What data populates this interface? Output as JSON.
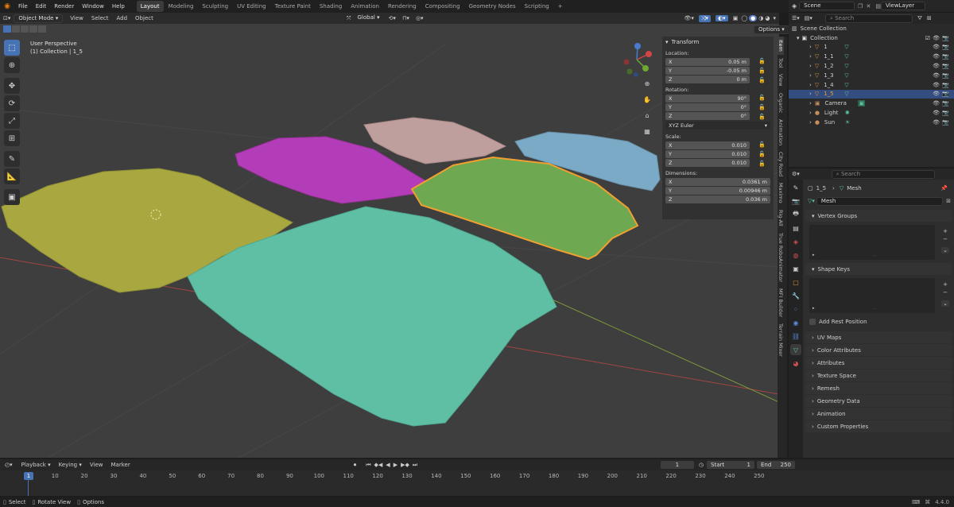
{
  "menu": {
    "items": [
      "File",
      "Edit",
      "Render",
      "Window",
      "Help"
    ],
    "workspaces": [
      "Layout",
      "Modeling",
      "Sculpting",
      "UV Editing",
      "Texture Paint",
      "Shading",
      "Animation",
      "Rendering",
      "Compositing",
      "Geometry Nodes",
      "Scripting"
    ],
    "active_workspace": "Layout",
    "add_tab": "+",
    "scene": "Scene",
    "view_layer": "ViewLayer"
  },
  "viewport": {
    "mode": "Object Mode",
    "menus": [
      "View",
      "Select",
      "Add",
      "Object"
    ],
    "orientation": "Global",
    "options": "Options",
    "perspective": "User Perspective",
    "collection_info": "(1) Collection | 1_5",
    "gizmo": {
      "x": "X",
      "y": "Y",
      "z": "Z"
    }
  },
  "transform": {
    "title": "Transform",
    "location_label": "Location:",
    "location": [
      {
        "axis": "X",
        "value": "0.05 m"
      },
      {
        "axis": "Y",
        "value": "-0.05 m"
      },
      {
        "axis": "Z",
        "value": "0 m"
      }
    ],
    "rotation_label": "Rotation:",
    "rotation": [
      {
        "axis": "X",
        "value": "90°"
      },
      {
        "axis": "Y",
        "value": "0°"
      },
      {
        "axis": "Z",
        "value": "0°"
      }
    ],
    "rotation_mode": "XYZ Euler",
    "scale_label": "Scale:",
    "scale": [
      {
        "axis": "X",
        "value": "0.010"
      },
      {
        "axis": "Y",
        "value": "0.010"
      },
      {
        "axis": "Z",
        "value": "0.010"
      }
    ],
    "dimensions_label": "Dimensions:",
    "dimensions": [
      {
        "axis": "X",
        "value": "0.0361 m"
      },
      {
        "axis": "Y",
        "value": "0.00946 m"
      },
      {
        "axis": "Z",
        "value": "0.036 m"
      }
    ]
  },
  "sidebar_tabs": [
    "Item",
    "Tool",
    "View",
    "Organic",
    "Animation",
    "City Road",
    "Maximo",
    "Rig-All",
    "True RoboAnimator",
    "MFI Builder",
    "Terrain Mixer"
  ],
  "outliner": {
    "search_placeholder": "Search",
    "root": "Scene Collection",
    "collection": "Collection",
    "objects": [
      {
        "name": "1",
        "color": "#e0943a",
        "selected": false
      },
      {
        "name": "1_1",
        "color": "#e0943a",
        "selected": false
      },
      {
        "name": "1_2",
        "color": "#e0943a",
        "selected": false
      },
      {
        "name": "1_3",
        "color": "#e0943a",
        "selected": false
      },
      {
        "name": "1_4",
        "color": "#e0943a",
        "selected": false
      },
      {
        "name": "1_5",
        "color": "#e0943a",
        "selected": true
      },
      {
        "name": "Camera",
        "color": "#c48f5c",
        "selected": false
      },
      {
        "name": "Light",
        "color": "#c48f5c",
        "selected": false
      },
      {
        "name": "Sun",
        "color": "#c48f5c",
        "selected": false
      }
    ]
  },
  "properties": {
    "search_placeholder": "Search",
    "breadcrumb_object": "1_5",
    "breadcrumb_data": "Mesh",
    "mesh_name": "Mesh",
    "vertex_groups": "Vertex Groups",
    "shape_keys": "Shape Keys",
    "add_rest_position": "Add Rest Position",
    "panels": [
      "UV Maps",
      "Color Attributes",
      "Attributes",
      "Texture Space",
      "Remesh",
      "Geometry Data",
      "Animation",
      "Custom Properties"
    ]
  },
  "timeline": {
    "menus": [
      "Playback",
      "Keying",
      "View",
      "Marker"
    ],
    "current_frame": "1",
    "start_label": "Start",
    "start": "1",
    "end_label": "End",
    "end": "250",
    "ticks": [
      "1",
      "10",
      "20",
      "30",
      "40",
      "50",
      "60",
      "70",
      "80",
      "90",
      "100",
      "110",
      "120",
      "130",
      "140",
      "150",
      "160",
      "170",
      "180",
      "190",
      "200",
      "210",
      "220",
      "230",
      "240",
      "250"
    ]
  },
  "status": {
    "select": "Select",
    "rotate": "Rotate View",
    "options": "Options",
    "version": "4.4.0"
  },
  "colors": {
    "terrain_yellow": "#a9a840",
    "terrain_teal": "#5fbfa5",
    "terrain_magenta": "#b33db8",
    "terrain_pink": "#bf9e9e",
    "terrain_blue": "#7aaac5",
    "terrain_green": "#6ea851",
    "selection_outline": "#f0a030",
    "accent": "#4772b3"
  }
}
